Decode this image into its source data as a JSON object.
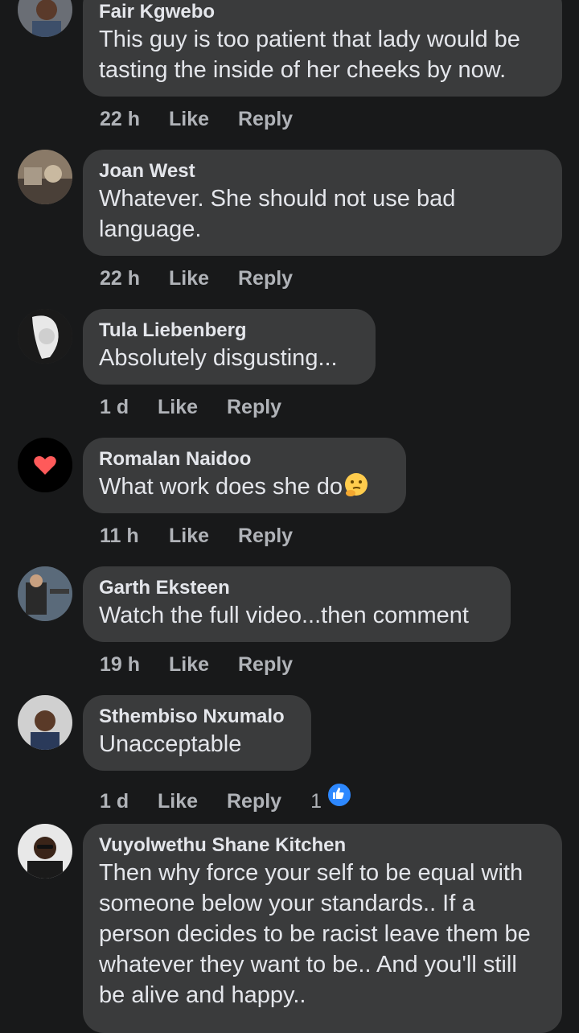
{
  "comments": [
    {
      "author": "Fair Kgwebo",
      "text": "This guy is too patient that lady would be tasting the inside of her cheeks by now.",
      "time": "22 h",
      "like_label": "Like",
      "reply_label": "Reply"
    },
    {
      "author": "Joan West",
      "text": "Whatever. She should not use bad language.",
      "time": "22 h",
      "like_label": "Like",
      "reply_label": "Reply"
    },
    {
      "author": "Tula Liebenberg",
      "text": "Absolutely disgusting...",
      "time": "1 d",
      "like_label": "Like",
      "reply_label": "Reply"
    },
    {
      "author": "Romalan Naidoo",
      "text": "What work does she do",
      "emoji": "thinking-face",
      "time": "11 h",
      "like_label": "Like",
      "reply_label": "Reply"
    },
    {
      "author": "Garth Eksteen",
      "text": "Watch the full video...then comment",
      "time": "19 h",
      "like_label": "Like",
      "reply_label": "Reply"
    },
    {
      "author": "Sthembiso Nxumalo",
      "text": "Unacceptable",
      "time": "1 d",
      "like_label": "Like",
      "reply_label": "Reply",
      "reaction_count": "1",
      "reaction_icon": "like-reaction-icon"
    },
    {
      "author": "Vuyolwethu Shane Kitchen",
      "text": "Then why force your self to be equal with someone below your standards.. If a person decides to be racist leave them be whatever they want to be.. And you'll still be alive and happy..",
      "time": "",
      "like_label": "",
      "reply_label": ""
    }
  ],
  "colors": {
    "background": "#18191a",
    "bubble": "#3a3b3c",
    "text": "#e4e6eb",
    "meta": "#b0b3b8",
    "like_blue": "#2d88ff"
  }
}
